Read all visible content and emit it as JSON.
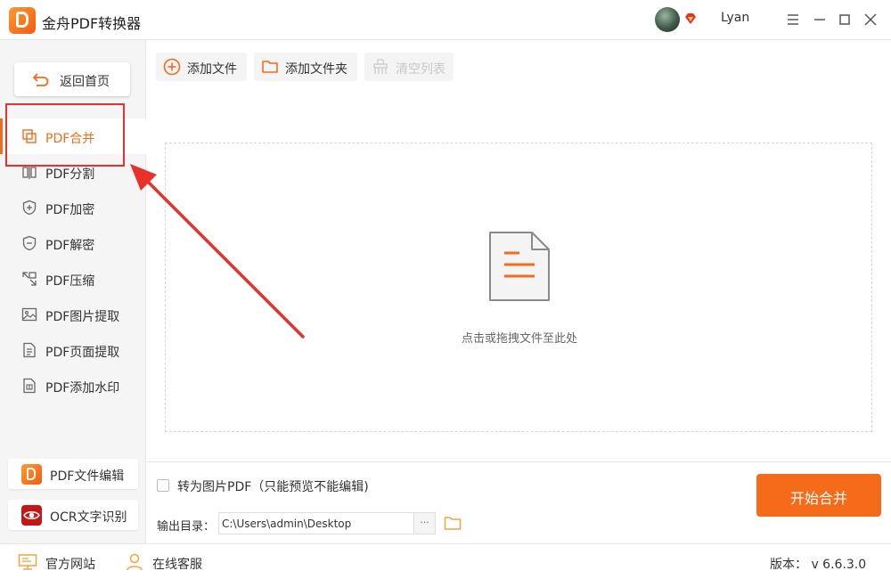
{
  "app": {
    "title": "金舟PDF转换器"
  },
  "user": {
    "name": "Lyan"
  },
  "sidebar": {
    "back_label": "返回首页",
    "items": [
      {
        "label": "PDF合并",
        "icon": "merge-icon"
      },
      {
        "label": "PDF分割",
        "icon": "split-icon"
      },
      {
        "label": "PDF加密",
        "icon": "shield-plus-icon"
      },
      {
        "label": "PDF解密",
        "icon": "shield-minus-icon"
      },
      {
        "label": "PDF压缩",
        "icon": "compress-icon"
      },
      {
        "label": "PDF图片提取",
        "icon": "image-icon"
      },
      {
        "label": "PDF页面提取",
        "icon": "page-icon"
      },
      {
        "label": "PDF添加水印",
        "icon": "watermark-icon"
      }
    ],
    "tools": [
      {
        "label": "PDF文件编辑",
        "icon": "pdf-edit-icon"
      },
      {
        "label": "OCR文字识别",
        "icon": "ocr-eye-icon"
      }
    ]
  },
  "toolbar": {
    "add_file": "添加文件",
    "add_folder": "添加文件夹",
    "clear_list": "清空列表"
  },
  "dropzone": {
    "hint": "点击或拖拽文件至此处"
  },
  "options": {
    "convert_to_image_pdf": "转为图片PDF（只能预览不能编辑)",
    "output_label": "输出目录：",
    "output_path": "C:\\Users\\admin\\Desktop",
    "browse_label": "···",
    "start_button": "开始合并"
  },
  "statusbar": {
    "website": "官方网站",
    "support": "在线客服",
    "version": "版本： v 6.6.3.0"
  },
  "colors": {
    "accent": "#f56b1a",
    "annotation": "#e8312a"
  }
}
